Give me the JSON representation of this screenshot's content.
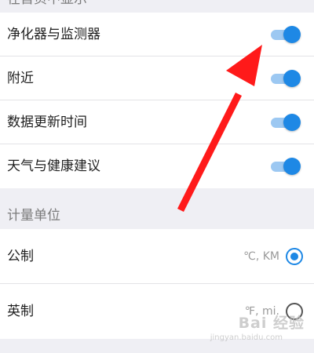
{
  "sections": {
    "top_header": "在首页中显示",
    "units_header": "计量单位"
  },
  "toggles": [
    {
      "label": "净化器与监测器",
      "on": true
    },
    {
      "label": "附近",
      "on": true
    },
    {
      "label": "数据更新时间",
      "on": true
    },
    {
      "label": "天气与健康建议",
      "on": true
    }
  ],
  "units": [
    {
      "label": "公制",
      "detail": "℃, KM",
      "selected": true
    },
    {
      "label": "英制",
      "detail": "℉, mi.",
      "selected": false
    }
  ],
  "annotation": {
    "color": "#ff1a1a"
  },
  "watermark": {
    "text": "Bai 经验",
    "sub": "jingyan.baidu.com"
  },
  "colors": {
    "accent": "#1e88e5",
    "track_on": "#9cc8f2",
    "background": "#efeff4"
  }
}
